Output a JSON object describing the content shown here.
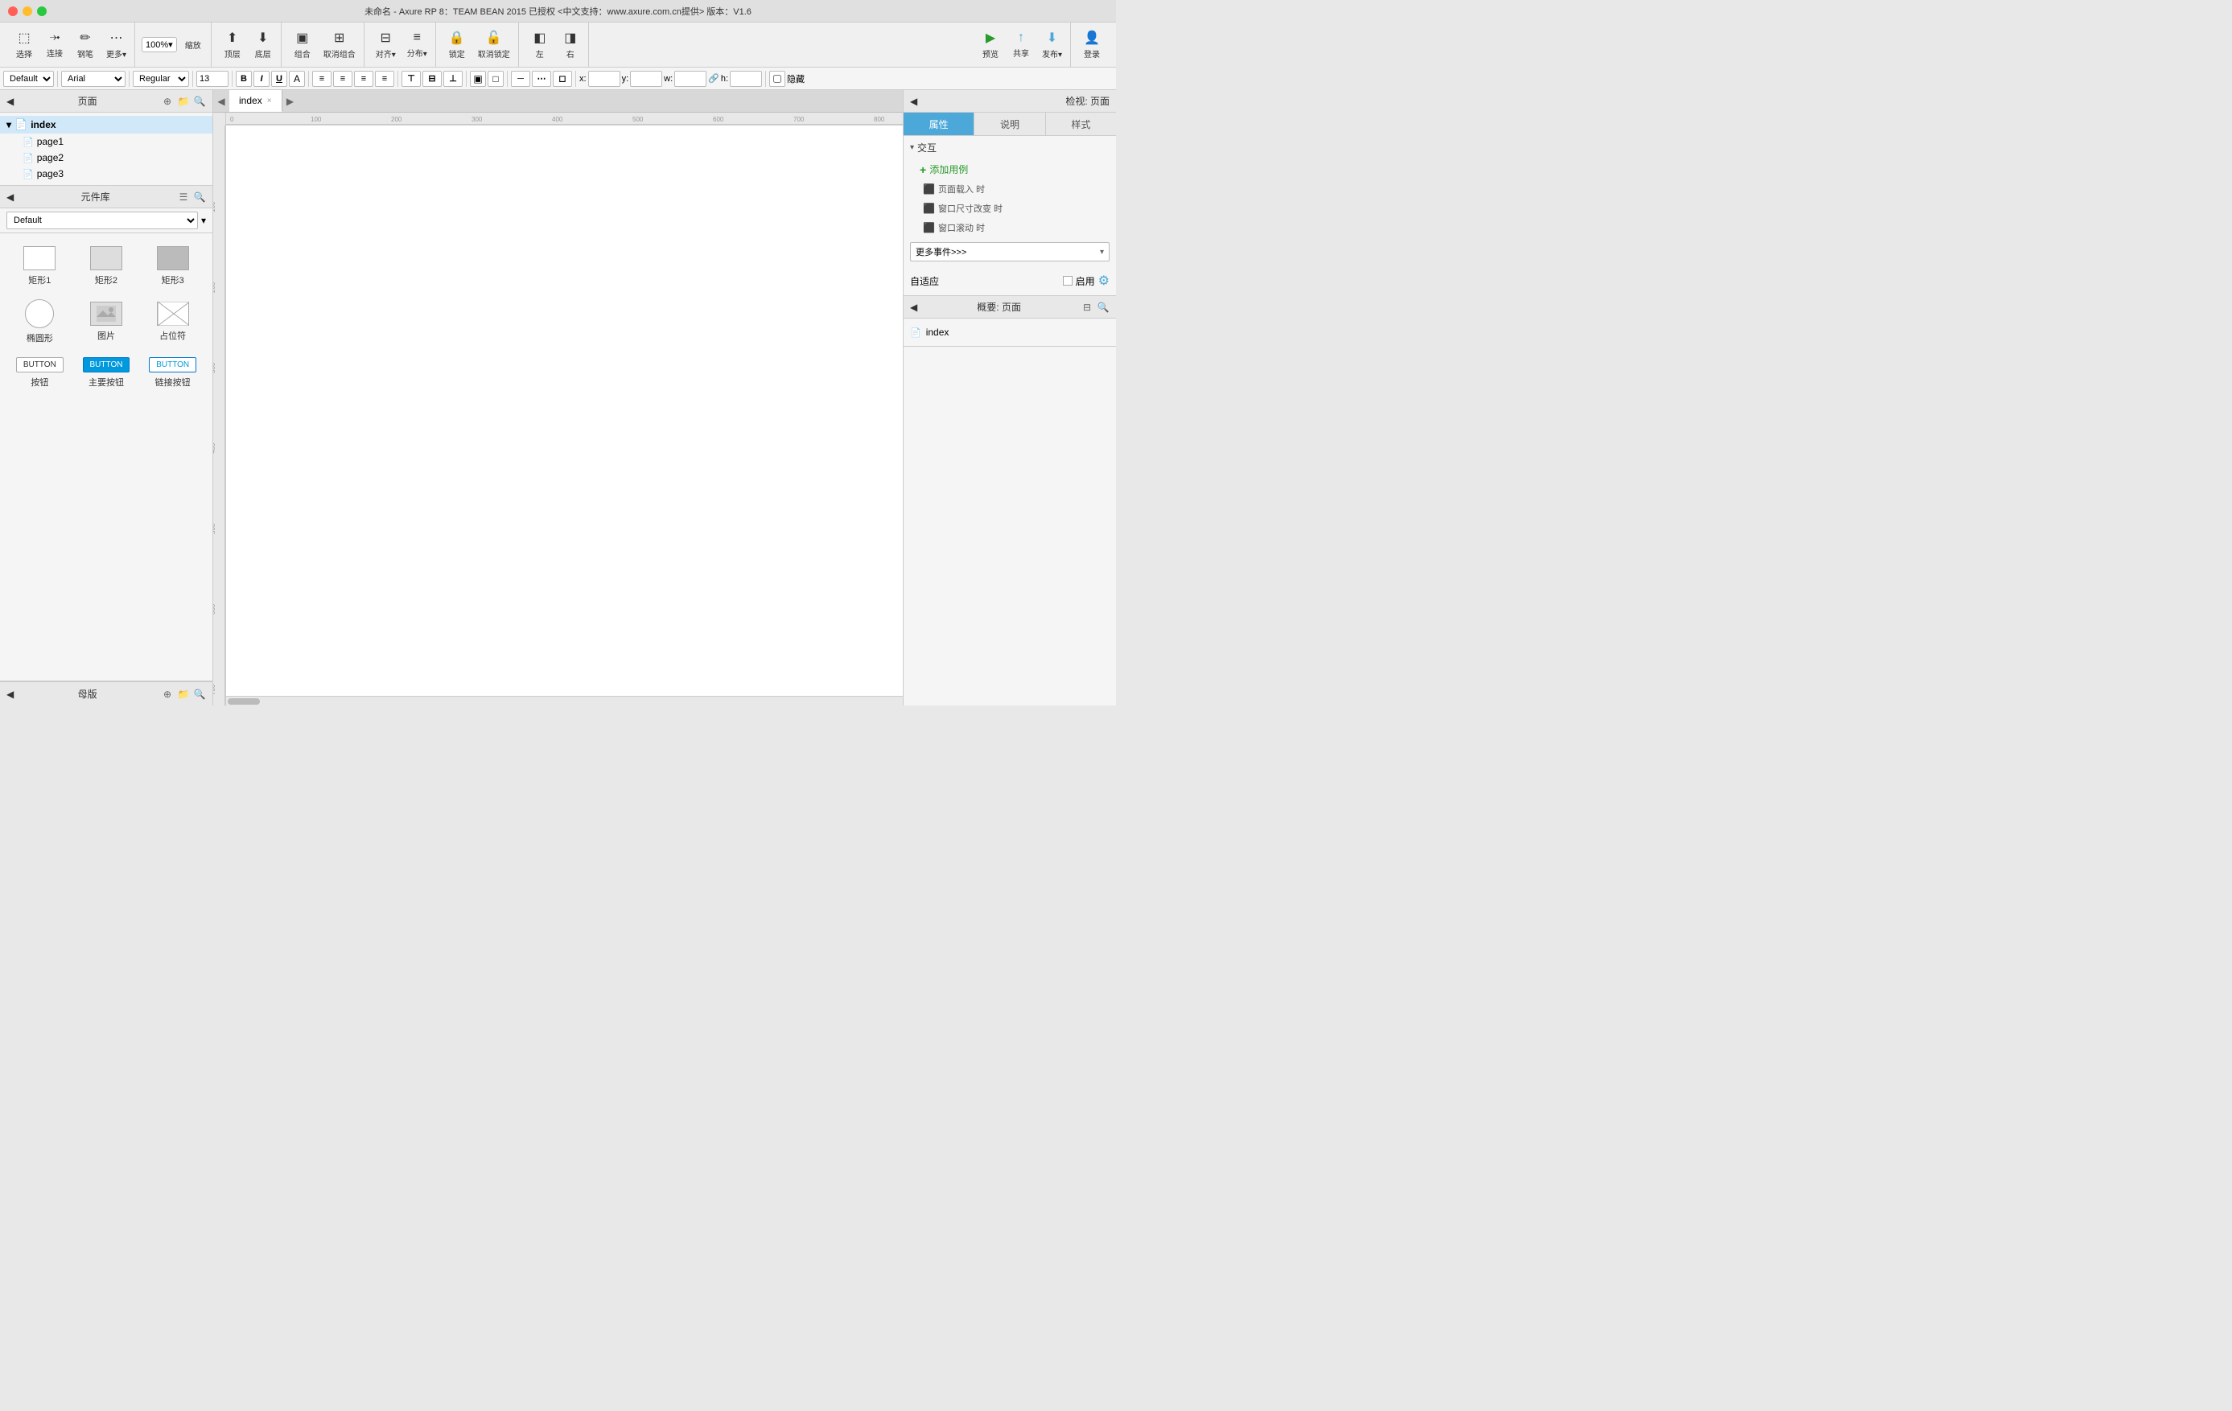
{
  "title_bar": {
    "title": "未命名 - Axure RP 8：TEAM BEAN 2015 已授权    <中文支持：www.axure.com.cn提供> 版本：V1.6"
  },
  "toolbar": {
    "select_label": "选择",
    "connect_label": "连接",
    "pen_label": "钢笔",
    "more_label": "更多▾",
    "zoom_value": "100%",
    "zoom_label": "缩放",
    "top_layer_label": "顶层",
    "bottom_layer_label": "底层",
    "group_label": "组合",
    "ungroup_label": "取消组合",
    "align_label": "对齐▾",
    "distribute_label": "分布▾",
    "lock_label": "锁定",
    "unlock_label": "取消锁定",
    "left_label": "左",
    "right_label": "右",
    "preview_label": "预览",
    "share_label": "共享",
    "publish_label": "发布▾",
    "login_label": "登录"
  },
  "format_bar": {
    "style_default": "Default",
    "font_default": "Arial",
    "weight_default": "Regular",
    "size_default": "13",
    "x_label": "x:",
    "y_label": "y:",
    "w_label": "w:",
    "h_label": "h:",
    "hide_label": "隐藏"
  },
  "left_panel": {
    "pages_title": "页面",
    "pages": [
      {
        "id": "index",
        "label": "index",
        "type": "folder",
        "level": 0,
        "active": true
      },
      {
        "id": "page1",
        "label": "page1",
        "type": "doc",
        "level": 1,
        "active": false
      },
      {
        "id": "page2",
        "label": "page2",
        "type": "doc",
        "level": 1,
        "active": false
      },
      {
        "id": "page3",
        "label": "page3",
        "type": "doc",
        "level": 1,
        "active": false
      }
    ],
    "widgets_title": "元件库",
    "widgets_default": "Default",
    "widgets": [
      {
        "id": "rect1",
        "label": "矩形1",
        "shape": "rect1"
      },
      {
        "id": "rect2",
        "label": "矩形2",
        "shape": "rect2"
      },
      {
        "id": "rect3",
        "label": "矩形3",
        "shape": "rect3"
      },
      {
        "id": "circle",
        "label": "椭圆形",
        "shape": "circle"
      },
      {
        "id": "image",
        "label": "图片",
        "shape": "image"
      },
      {
        "id": "placeholder",
        "label": "占位符",
        "shape": "placeholder"
      },
      {
        "id": "btn",
        "label": "按钮",
        "shape": "btn"
      },
      {
        "id": "btn-primary",
        "label": "主要按钮",
        "shape": "btn-primary"
      },
      {
        "id": "btn-link",
        "label": "链接按钮",
        "shape": "btn-link"
      }
    ],
    "master_title": "母版"
  },
  "canvas": {
    "active_tab": "index",
    "tab_close": "×",
    "ruler_marks": [
      "0",
      "100",
      "200",
      "300",
      "400",
      "500",
      "600",
      "700",
      "800"
    ]
  },
  "right_panel": {
    "inspect_title": "检视: 页面",
    "tabs": [
      "属性",
      "说明",
      "样式"
    ],
    "active_tab": "属性",
    "interaction_title": "交互",
    "add_usecase_label": "添加用例",
    "events": [
      {
        "label": "页面载入 时"
      },
      {
        "label": "窗口尺寸改变 时"
      },
      {
        "label": "窗口滚动 时"
      }
    ],
    "more_events_label": "更多事件>>>",
    "adaptive_title": "自适应",
    "adaptive_enable_label": "启用",
    "overview_title": "概要: 页面",
    "overview_items": [
      {
        "id": "index",
        "label": "index"
      }
    ]
  }
}
